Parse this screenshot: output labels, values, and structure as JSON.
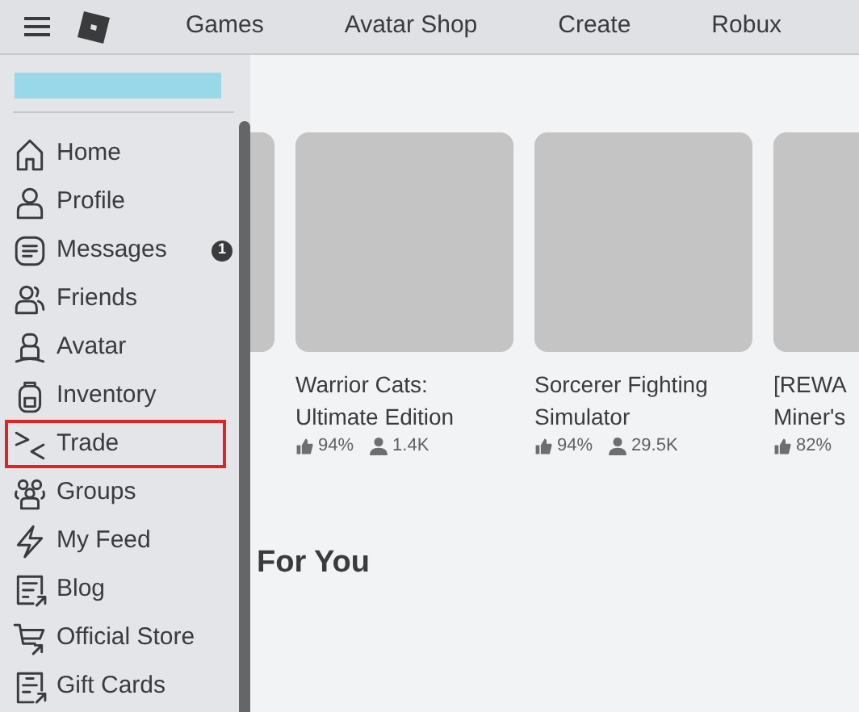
{
  "top_nav": {
    "items": [
      "Games",
      "Avatar Shop",
      "Create",
      "Robux"
    ]
  },
  "sidebar": {
    "items": [
      {
        "label": "Home",
        "selected": false
      },
      {
        "label": "Profile",
        "selected": false
      },
      {
        "label": "Messages",
        "selected": false,
        "badge": "1"
      },
      {
        "label": "Friends",
        "selected": false
      },
      {
        "label": "Avatar",
        "selected": false
      },
      {
        "label": "Inventory",
        "selected": false
      },
      {
        "label": "Trade",
        "selected": true
      },
      {
        "label": "Groups",
        "selected": false
      },
      {
        "label": "My Feed",
        "selected": false
      },
      {
        "label": "Blog",
        "selected": false
      },
      {
        "label": "Official Store",
        "selected": false
      },
      {
        "label": "Gift Cards",
        "selected": false
      }
    ]
  },
  "games": [
    {
      "kind": "cut"
    },
    {
      "kind": "full",
      "title": [
        "Warrior Cats:",
        "Ultimate Edition"
      ],
      "rating": "94%",
      "players": "1.4K"
    },
    {
      "kind": "full",
      "title": [
        "Sorcerer Fighting",
        "Simulator"
      ],
      "rating": "94%",
      "players": "29.5K"
    },
    {
      "kind": "full",
      "title": [
        "[REWA",
        "Miner's"
      ],
      "rating": "82%"
    }
  ],
  "section_title": "For You"
}
